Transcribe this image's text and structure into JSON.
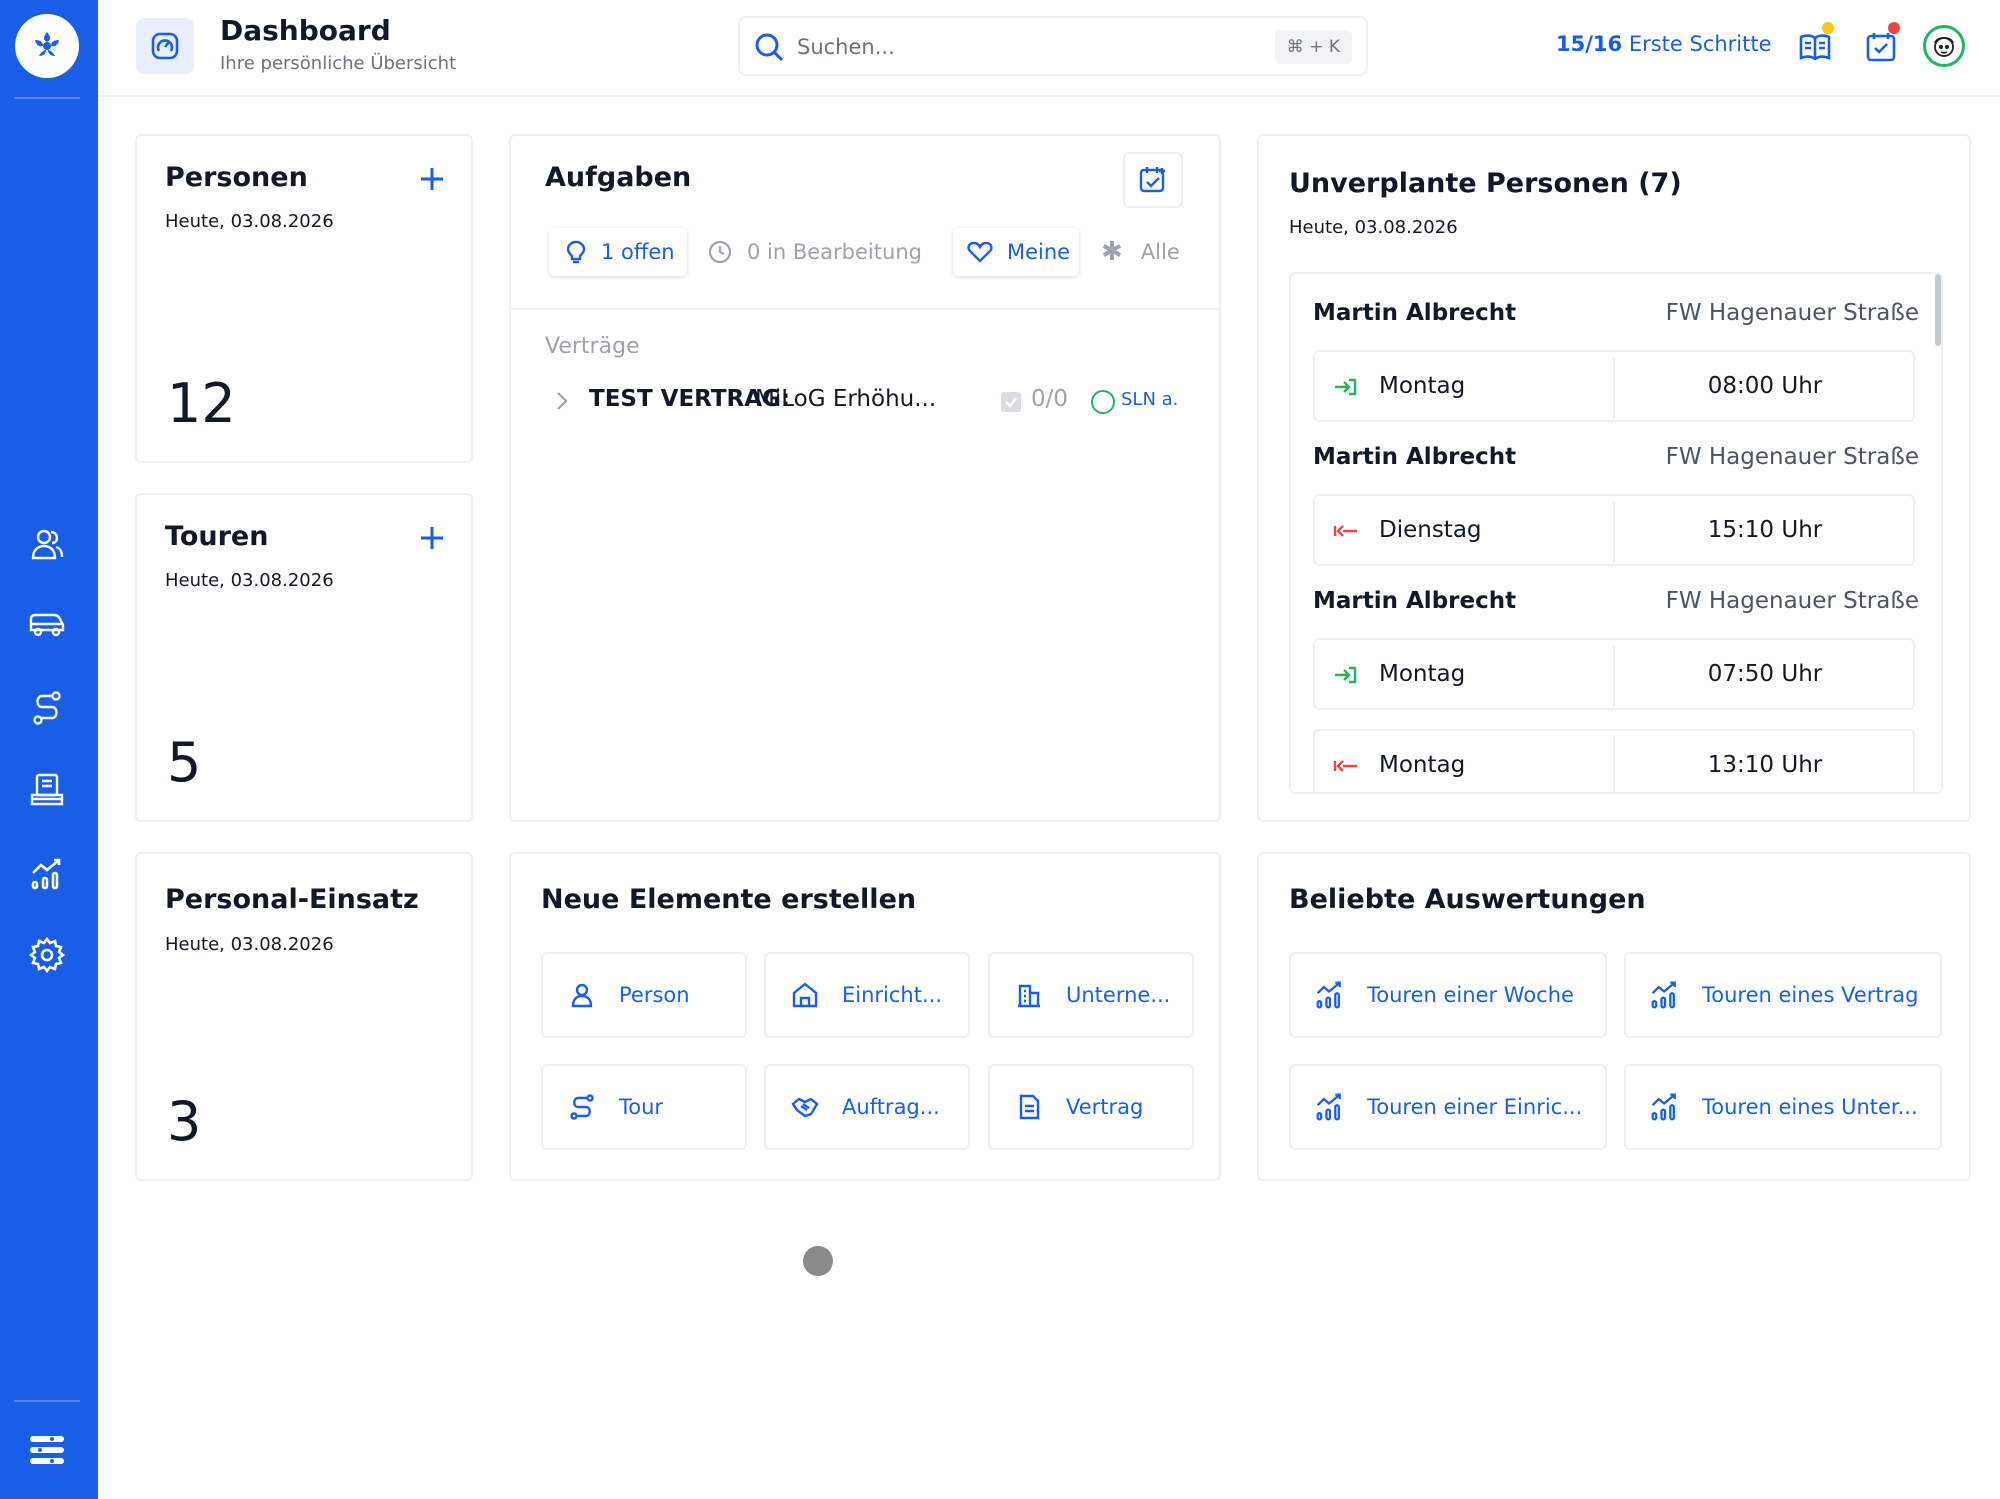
{
  "header": {
    "title": "Dashboard",
    "subtitle": "Ihre persönliche Übersicht",
    "search_placeholder": "Suchen...",
    "search_shortcut": "⌘ + K",
    "steps_count": "15/16",
    "steps_label": "Erste Schritte"
  },
  "colors": {
    "primary": "#1a5ee8",
    "sidebar": "#1a5ee8",
    "green": "#22b55f",
    "red": "#ef4444",
    "yellow": "#f5c518"
  },
  "sidebar": {
    "items": [
      {
        "icon": "users-icon"
      },
      {
        "icon": "vehicle-icon"
      },
      {
        "icon": "route-icon"
      },
      {
        "icon": "reports-desk-icon"
      },
      {
        "icon": "analytics-icon"
      },
      {
        "icon": "settings-gear-icon"
      }
    ]
  },
  "cards": {
    "personen": {
      "title": "Personen",
      "date": "Heute, 03.08.2026",
      "value": "12"
    },
    "touren": {
      "title": "Touren",
      "date": "Heute, 03.08.2026",
      "value": "5"
    },
    "einsatz": {
      "title": "Personal-Einsatz",
      "date": "Heute, 03.08.2026",
      "value": "3"
    }
  },
  "aufgaben": {
    "title": "Aufgaben",
    "tabs": {
      "offen": "1 offen",
      "bearbeitung": "0 in Bearbeitung",
      "meine": "Meine",
      "alle": "Alle"
    },
    "section": "Verträge",
    "task": {
      "bold": "TEST VERTRAG:",
      "text": "MiLoG Erhöhu...",
      "count": "0/0",
      "tag": "SLN a."
    }
  },
  "unverplant": {
    "title": "Unverplante Personen (7)",
    "date": "Heute, 03.08.2026",
    "groups": [
      {
        "name": "Martin Albrecht",
        "place": "FW Hagenauer Straße",
        "slots": [
          {
            "dir": "in",
            "day": "Montag",
            "time": "08:00 Uhr"
          }
        ]
      },
      {
        "name": "Martin Albrecht",
        "place": "FW Hagenauer Straße",
        "slots": [
          {
            "dir": "out",
            "day": "Dienstag",
            "time": "15:10 Uhr"
          }
        ]
      },
      {
        "name": "Martin Albrecht",
        "place": "FW Hagenauer Straße",
        "slots": [
          {
            "dir": "in",
            "day": "Montag",
            "time": "07:50 Uhr"
          },
          {
            "dir": "out",
            "day": "Montag",
            "time": "13:10 Uhr"
          }
        ]
      }
    ]
  },
  "neue": {
    "title": "Neue Elemente erstellen",
    "items": [
      {
        "label": "Person",
        "icon": "person-icon"
      },
      {
        "label": "Einricht...",
        "icon": "house-icon"
      },
      {
        "label": "Unterne...",
        "icon": "building-icon"
      },
      {
        "label": "Tour",
        "icon": "route-icon"
      },
      {
        "label": "Auftrag...",
        "icon": "handshake-icon"
      },
      {
        "label": "Vertrag",
        "icon": "document-icon"
      }
    ]
  },
  "auswertungen": {
    "title": "Beliebte Auswertungen",
    "items": [
      {
        "label": "Touren einer Woche",
        "icon": "chart-icon"
      },
      {
        "label": "Touren eines Vertrag",
        "icon": "chart-icon"
      },
      {
        "label": "Touren einer Einric...",
        "icon": "chart-icon"
      },
      {
        "label": "Touren eines Unter...",
        "icon": "chart-icon"
      }
    ]
  }
}
